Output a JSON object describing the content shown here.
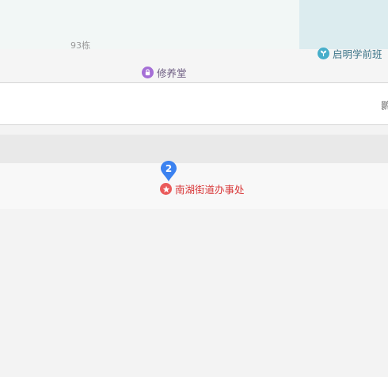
{
  "map": {
    "labels": {
      "building": "93栋",
      "poi_xiuyangtang": "修养堂",
      "poi_qiming": "启明学前班",
      "poi_edge": "鹮",
      "poi_office": "南湖街道办事处"
    },
    "marker": {
      "number": "2"
    },
    "colors": {
      "background": "#f3f3f3",
      "building_block": "#f2f7f6",
      "water": "#dcecef",
      "road": "#ffffff",
      "road_border": "#d6d6d6",
      "gray_strip": "#e9e9e9",
      "purple_icon": "#a56fd6",
      "teal_icon": "#47aeca",
      "red_icon": "#ea5b5b",
      "marker_blue": "#3b82f0",
      "office_text": "#d9393a"
    },
    "icons": {
      "poi_xiuyangtang": "lock-bag-icon",
      "poi_qiming": "sprout-icon",
      "poi_office": "government-star-icon",
      "marker": "map-pin-icon"
    }
  }
}
